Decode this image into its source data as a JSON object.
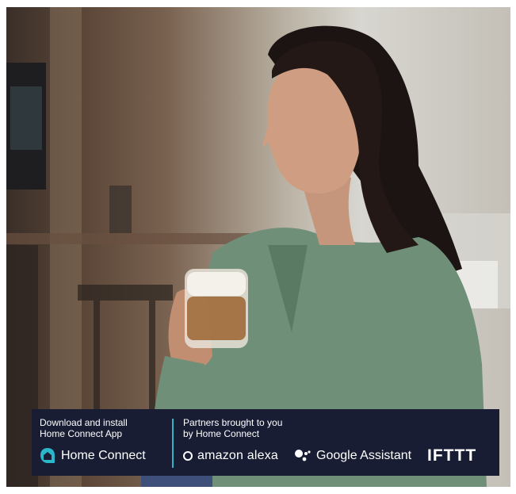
{
  "promo": {
    "left_caption_line1": "Download and install",
    "left_caption_line2": "Home Connect App",
    "right_caption_line1": "Partners brought to you",
    "right_caption_line2": "by Home Connect",
    "logos": {
      "home_connect": "Home Connect",
      "alexa": "amazon alexa",
      "google_assistant": "Google Assistant",
      "ifttt": "IFTTT"
    }
  },
  "colors": {
    "banner_background": "#181d34",
    "accent_divider": "#2bb6c9",
    "home_connect_icon": "#2bb6c9",
    "text": "#ffffff"
  }
}
